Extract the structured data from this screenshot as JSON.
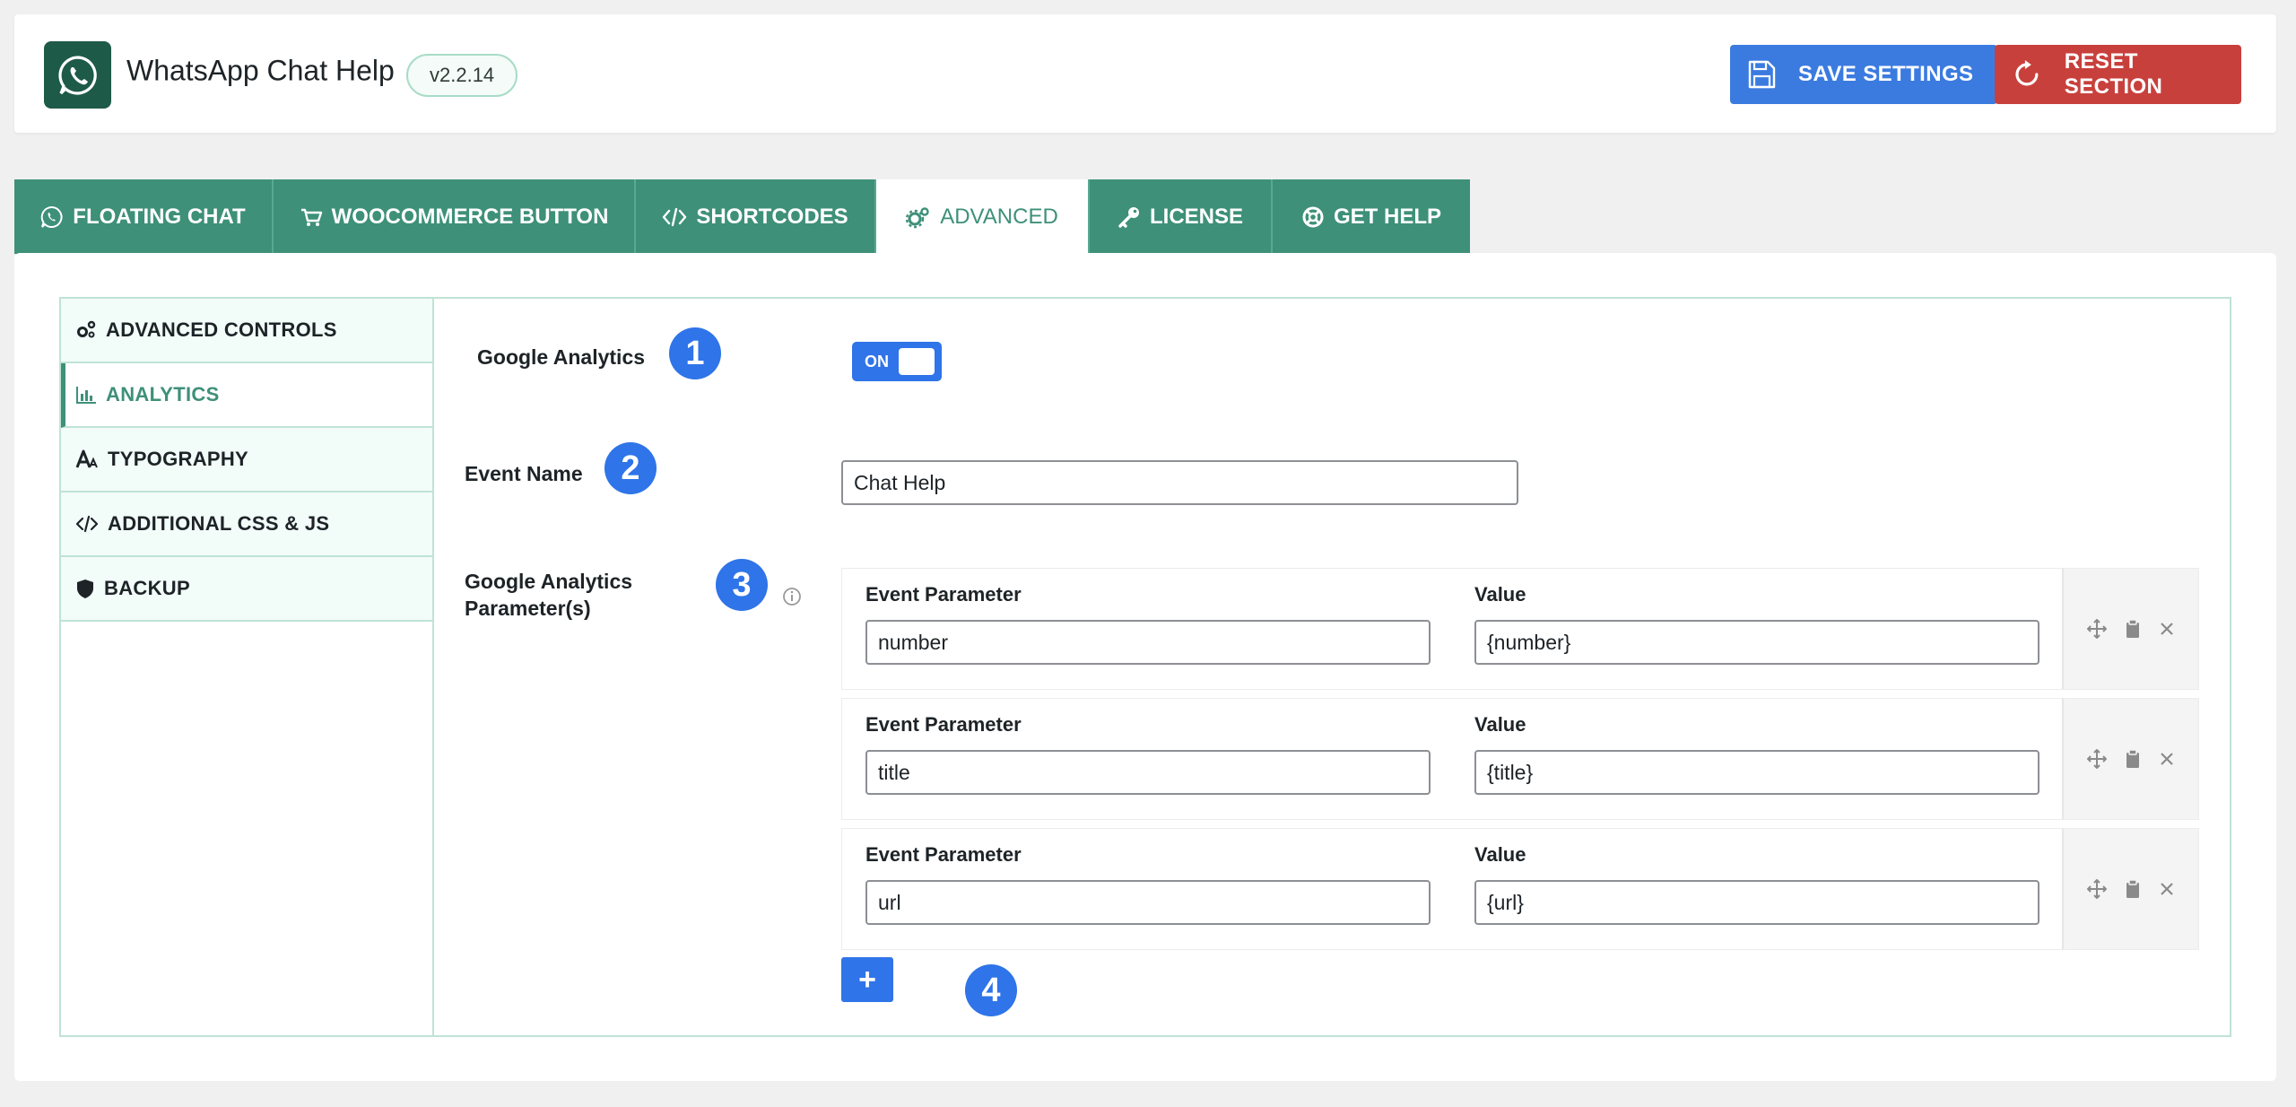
{
  "header": {
    "title": "WhatsApp Chat Help",
    "version": "v2.2.14",
    "save_label": "SAVE SETTINGS",
    "reset_label": "RESET SECTION"
  },
  "tabs": [
    {
      "label": "FLOATING CHAT",
      "icon": "whatsapp-icon"
    },
    {
      "label": "WOOCOMMERCE BUTTON",
      "icon": "cart-icon"
    },
    {
      "label": "SHORTCODES",
      "icon": "code-icon"
    },
    {
      "label": "ADVANCED",
      "icon": "gears-icon",
      "active": true
    },
    {
      "label": "LICENSE",
      "icon": "key-icon"
    },
    {
      "label": "GET HELP",
      "icon": "lifering-icon"
    }
  ],
  "sidebar": {
    "items": [
      {
        "label": "ADVANCED CONTROLS",
        "icon": "gears-icon"
      },
      {
        "label": "ANALYTICS",
        "icon": "bar-chart-icon",
        "active": true
      },
      {
        "label": "TYPOGRAPHY",
        "icon": "font-icon"
      },
      {
        "label": "ADDITIONAL CSS & JS",
        "icon": "code-icon"
      },
      {
        "label": "BACKUP",
        "icon": "shield-icon"
      }
    ]
  },
  "analytics": {
    "ga_label": "Google Analytics",
    "ga_toggle": "ON",
    "event_name_label": "Event Name",
    "event_name_value": "Chat Help",
    "params_label_line1": "Google Analytics",
    "params_label_line2": "Parameter(s)",
    "param_col_label": "Event Parameter",
    "value_col_label": "Value",
    "params": [
      {
        "parameter": "number",
        "value": "{number}"
      },
      {
        "parameter": "title",
        "value": "{title}"
      },
      {
        "parameter": "url",
        "value": "{url}"
      }
    ],
    "add_label": "+"
  },
  "badges": [
    "1",
    "2",
    "3",
    "4"
  ],
  "colors": {
    "teal": "#3e9079",
    "blue": "#2f74e8",
    "save": "#3b7be0",
    "reset": "#c8403c",
    "logo": "#1e5a48"
  }
}
